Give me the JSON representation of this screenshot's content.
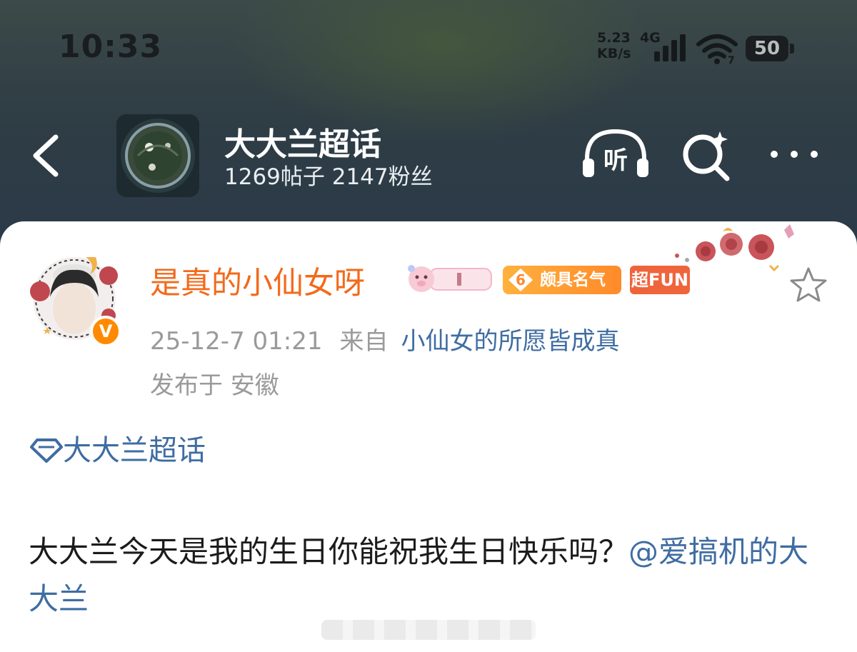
{
  "status_bar": {
    "time": "10:33",
    "speed_value": "5.23",
    "speed_unit": "KB/s",
    "network": "4G",
    "wifi_badge": "7",
    "battery": "50"
  },
  "header": {
    "title": "大大兰超话",
    "stats": "1269帖子 2147粉丝",
    "listen_label": "听",
    "icons": [
      "back-arrow-icon",
      "listen-headphones-icon",
      "search-sparkle-icon",
      "more-icon"
    ]
  },
  "post": {
    "username": "是真的小仙女呀",
    "medal_level": "6",
    "medal_label": "颇具名气",
    "medal_fun": "超FUN",
    "vip_mark": "V",
    "timestamp": "25-12-7 01:21",
    "from_label": "来自",
    "source": "小仙女的所愿皆成真",
    "location": "发布于 安徽",
    "topic": "大大兰超话",
    "text": "大大兰今天是我的生日你能祝我生日快乐吗？",
    "mention": "@爱搞机的大大兰"
  },
  "colors": {
    "username": "#f26a1b",
    "link": "#3f6da2",
    "meta": "#9a9a9a",
    "fun_badge": "#f0643c"
  }
}
